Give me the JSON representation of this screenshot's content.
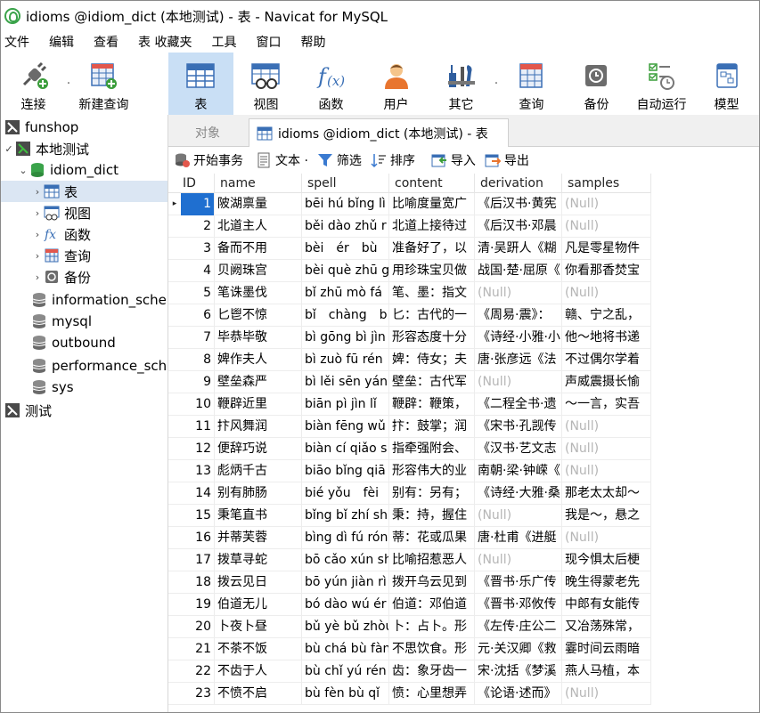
{
  "window": {
    "title": "idioms @idiom_dict (本地测试) - 表 - Navicat for MySQL"
  },
  "menu": [
    "文件",
    "编辑",
    "查看",
    "表 收藏夹",
    "工具",
    "窗口",
    "帮助"
  ],
  "toolbar": {
    "connect": "连接",
    "new_query": "新建查询",
    "table": "表",
    "view": "视图",
    "function": "函数",
    "user": "用户",
    "other": "其它",
    "query": "查询",
    "backup": "备份",
    "automation": "自动运行",
    "model": "模型"
  },
  "sidebar": {
    "items": [
      {
        "label": "funshop"
      },
      {
        "label": "本地测试"
      },
      {
        "label": "idiom_dict"
      },
      {
        "label": "表"
      },
      {
        "label": "视图"
      },
      {
        "label": "函数"
      },
      {
        "label": "查询"
      },
      {
        "label": "备份"
      },
      {
        "label": "information_schema"
      },
      {
        "label": "mysql"
      },
      {
        "label": "outbound"
      },
      {
        "label": "performance_schema"
      },
      {
        "label": "sys"
      },
      {
        "label": "测试"
      }
    ]
  },
  "tabs": {
    "objects": "对象",
    "active": "idioms @idiom_dict (本地测试) - 表"
  },
  "subtoolbar": {
    "begin_transaction": "开始事务",
    "text": "文本 ·",
    "filter": "筛选",
    "sort": "排序",
    "import": "导入",
    "export": "导出"
  },
  "grid": {
    "columns": [
      "ID",
      "name",
      "spell",
      "content",
      "derivation",
      "samples"
    ],
    "rows": [
      [
        "1",
        "陂湖禀量",
        "bēi hú bǐng lì",
        "比喻度量宽广",
        "《后汉书·黄宪",
        "(Null)"
      ],
      [
        "2",
        "北道主人",
        "běi dào zhǔ r",
        "北道上接待过",
        "《后汉书·邓晨",
        "(Null)"
      ],
      [
        "3",
        "备而不用",
        "bèi　ér　bù",
        "准备好了，以",
        "清·吴趼人《糊",
        "凡是零星物件"
      ],
      [
        "4",
        "贝阙珠宫",
        "bèi què zhū g",
        "用珍珠宝贝做",
        "战国·楚·屈原《",
        "你看那香焚宝"
      ],
      [
        "5",
        "笔诛墨伐",
        "bǐ zhū mò fá",
        "笔、墨：指文",
        "(Null)",
        "(Null)"
      ],
      [
        "6",
        "匕鬯不惊",
        "bǐ　chàng　b",
        "匕：古代的一",
        "《周易·震》：",
        "赣、宁之乱，"
      ],
      [
        "7",
        "毕恭毕敬",
        "bì gōng bì jìn",
        "形容态度十分",
        "《诗经·小雅·小",
        "他～地将书递"
      ],
      [
        "8",
        "婢作夫人",
        "bì zuò fū rén",
        "婢：侍女；夫",
        "唐·张彦远《法",
        "不过偶尔学着"
      ],
      [
        "9",
        "壁垒森严",
        "bì lěi sēn yán",
        "壁垒：古代军",
        "(Null)",
        "声威震摄长愉"
      ],
      [
        "10",
        "鞭辟近里",
        "biān pì jìn lǐ",
        "鞭辟：鞭策，",
        "《二程全书·遗",
        "～一言，实吾"
      ],
      [
        "11",
        "抃风舞润",
        "biàn fēng wǔ",
        "抃：鼓掌；润",
        "《宋书·孔觊传",
        "(Null)"
      ],
      [
        "12",
        "便辞巧说",
        "biàn cí qiǎo s",
        "指牵强附会、",
        "《汉书·艺文志",
        "(Null)"
      ],
      [
        "13",
        "彪炳千古",
        "biāo bǐng qiā",
        "形容伟大的业",
        "南朝·梁·钟嵘《",
        "(Null)"
      ],
      [
        "14",
        "别有肺肠",
        "bié yǒu　fèi",
        "别有：另有；",
        "《诗经·大雅·桑",
        "那老太太却～"
      ],
      [
        "15",
        "秉笔直书",
        "bǐng bǐ zhí sh",
        "秉：持，握住",
        "(Null)",
        "我是～，悬之"
      ],
      [
        "16",
        "并蒂芙蓉",
        "bìng dì fú róng",
        "蒂：花或瓜果",
        "唐·杜甫《进艇",
        "(Null)"
      ],
      [
        "17",
        "拨草寻蛇",
        "bō cǎo xún sh",
        "比喻招惹恶人",
        "(Null)",
        "现今惧太后梗"
      ],
      [
        "18",
        "拨云见日",
        "bō yún jiàn rì",
        "拨开乌云见到",
        "《晋书·乐广传",
        "晚生得蒙老先"
      ],
      [
        "19",
        "伯道无儿",
        "bó dào wú ér",
        "伯道：邓伯道",
        "《晋书·邓攸传",
        "中郎有女能传"
      ],
      [
        "20",
        "卜夜卜昼",
        "bǔ yè bǔ zhòu",
        "卜：占卜。形",
        "《左传·庄公二",
        "又冶荡殊常，"
      ],
      [
        "21",
        "不茶不饭",
        "bù chá bù fàn",
        "不思饮食。形",
        "元·关汉卿《救",
        "霎时间云雨暗"
      ],
      [
        "22",
        "不齿于人",
        "bù chǐ yú rén",
        "齿：象牙齿一",
        "宋·沈括《梦溪",
        "燕人马植，本"
      ],
      [
        "23",
        "不愤不启",
        "bù fèn bù qǐ",
        "愤：心里想弄",
        "《论语·述而》",
        "(Null)"
      ]
    ]
  }
}
